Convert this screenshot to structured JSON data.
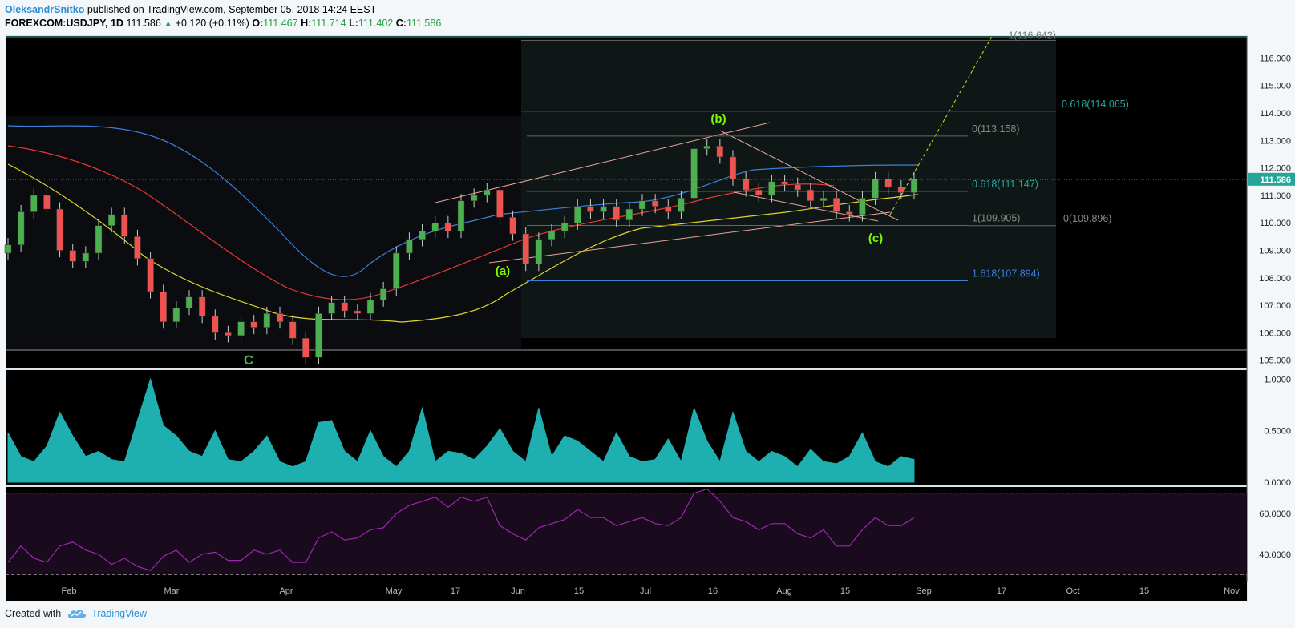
{
  "header": {
    "author": "OleksandrSnitko",
    "published": "published on TradingView.com, September 05, 2018 14:24 EEST",
    "symbol": "FOREXCOM:USDJPY",
    "interval": ", 1D",
    "last": "111.586",
    "change_arrow": "▲",
    "change": "+0.120 (+0.11%)",
    "o_label": "O:",
    "o": "111.467",
    "h_label": "H:",
    "h": "111.714",
    "l_label": "L:",
    "l": "111.402",
    "c_label": "C:",
    "c": "111.586"
  },
  "footer": {
    "created_with": "Created with",
    "brand": "TradingView",
    "logo_icon": "tradingview-cloud-icon"
  },
  "colors": {
    "bull": "#4caf50",
    "bear": "#ef5350",
    "ma_fast": "#3d7fd9",
    "ma_mid": "#e53935",
    "ma_slow": "#e0d52a",
    "volatility": "#1eb0b0",
    "rsi": "#9c27b0",
    "fib": "#26a69a",
    "trend": "#e8a49a"
  },
  "chart_data": {
    "type": "candlestick",
    "symbol": "FOREXCOM:USDJPY",
    "interval": "1D",
    "x_tick_labels": [
      "Feb",
      "Mar",
      "Apr",
      "May",
      "17",
      "Jun",
      "15",
      "Jul",
      "16",
      "Aug",
      "15",
      "Sep",
      "17",
      "Oct",
      "15",
      "Nov"
    ],
    "price_axis": {
      "ylim": [
        104.7,
        116.8
      ],
      "tick_labels": [
        "116.000",
        "115.000",
        "114.000",
        "113.000",
        "112.000",
        "111.000",
        "110.000",
        "109.000",
        "108.000",
        "107.000",
        "106.000",
        "105.000"
      ],
      "last_price_label": "111.586"
    },
    "price_series": [
      109.2,
      110.4,
      111.0,
      110.5,
      109.0,
      108.6,
      108.9,
      109.9,
      110.3,
      109.5,
      108.7,
      107.5,
      106.4,
      106.9,
      107.3,
      106.6,
      106.0,
      105.9,
      106.4,
      106.2,
      106.7,
      106.4,
      105.8,
      105.1,
      106.7,
      107.1,
      106.8,
      106.7,
      107.2,
      107.6,
      108.9,
      109.4,
      109.7,
      110.0,
      109.7,
      110.8,
      111.0,
      111.2,
      110.2,
      109.6,
      108.5,
      109.4,
      109.7,
      110.0,
      110.6,
      110.4,
      110.6,
      110.1,
      110.5,
      110.8,
      110.6,
      110.4,
      110.9,
      112.7,
      112.8,
      112.4,
      111.6,
      111.2,
      111.0,
      111.5,
      111.4,
      111.2,
      110.8,
      110.9,
      110.4,
      110.3,
      110.9,
      111.6,
      111.3,
      111.1,
      111.6
    ],
    "annotations": [
      "C",
      "(a)",
      "(b)",
      "(c)"
    ],
    "fib_levels": [
      {
        "label": "1(116.642)",
        "value": 116.642
      },
      {
        "label": "0.618(114.065)",
        "value": 114.065
      },
      {
        "label": "0(113.158)",
        "value": 113.158
      },
      {
        "label": "0.618(111.147)",
        "value": 111.147
      },
      {
        "label": "1(109.905)",
        "value": 109.905
      },
      {
        "label": "0(109.896)",
        "value": 109.896
      },
      {
        "label": "1.618(107.894)",
        "value": 107.894
      }
    ],
    "volatility": {
      "ylim": [
        0,
        1.05
      ],
      "tick_labels": [
        "1.0000",
        "0.5000",
        "0.0000"
      ],
      "values": [
        0.48,
        0.25,
        0.2,
        0.35,
        0.68,
        0.45,
        0.25,
        0.3,
        0.22,
        0.2,
        0.6,
        1.0,
        0.55,
        0.45,
        0.3,
        0.25,
        0.5,
        0.22,
        0.2,
        0.3,
        0.45,
        0.2,
        0.15,
        0.2,
        0.58,
        0.6,
        0.3,
        0.2,
        0.5,
        0.25,
        0.15,
        0.3,
        0.72,
        0.2,
        0.3,
        0.28,
        0.22,
        0.35,
        0.52,
        0.3,
        0.2,
        0.72,
        0.25,
        0.45,
        0.4,
        0.3,
        0.2,
        0.48,
        0.25,
        0.2,
        0.22,
        0.42,
        0.2,
        0.72,
        0.4,
        0.2,
        0.68,
        0.3,
        0.2,
        0.3,
        0.25,
        0.15,
        0.32,
        0.2,
        0.18,
        0.25,
        0.48,
        0.2,
        0.15,
        0.25,
        0.22
      ]
    },
    "rsi": {
      "ylim": [
        27,
        73
      ],
      "tick_labels": [
        "60.0000",
        "40.0000"
      ],
      "bands": [
        70,
        30
      ],
      "values": [
        36,
        44,
        38,
        36,
        44,
        46,
        42,
        40,
        35,
        38,
        34,
        32,
        39,
        42,
        36,
        40,
        41,
        37,
        37,
        42,
        40,
        42,
        36,
        36,
        48,
        51,
        47,
        48,
        52,
        53,
        60,
        64,
        66,
        68,
        63,
        68,
        66,
        68,
        54,
        50,
        47,
        53,
        55,
        57,
        62,
        58,
        58,
        54,
        56,
        58,
        55,
        54,
        58,
        70,
        72,
        66,
        58,
        56,
        52,
        55,
        55,
        50,
        48,
        52,
        44,
        44,
        52,
        58,
        54,
        54,
        58
      ]
    }
  }
}
